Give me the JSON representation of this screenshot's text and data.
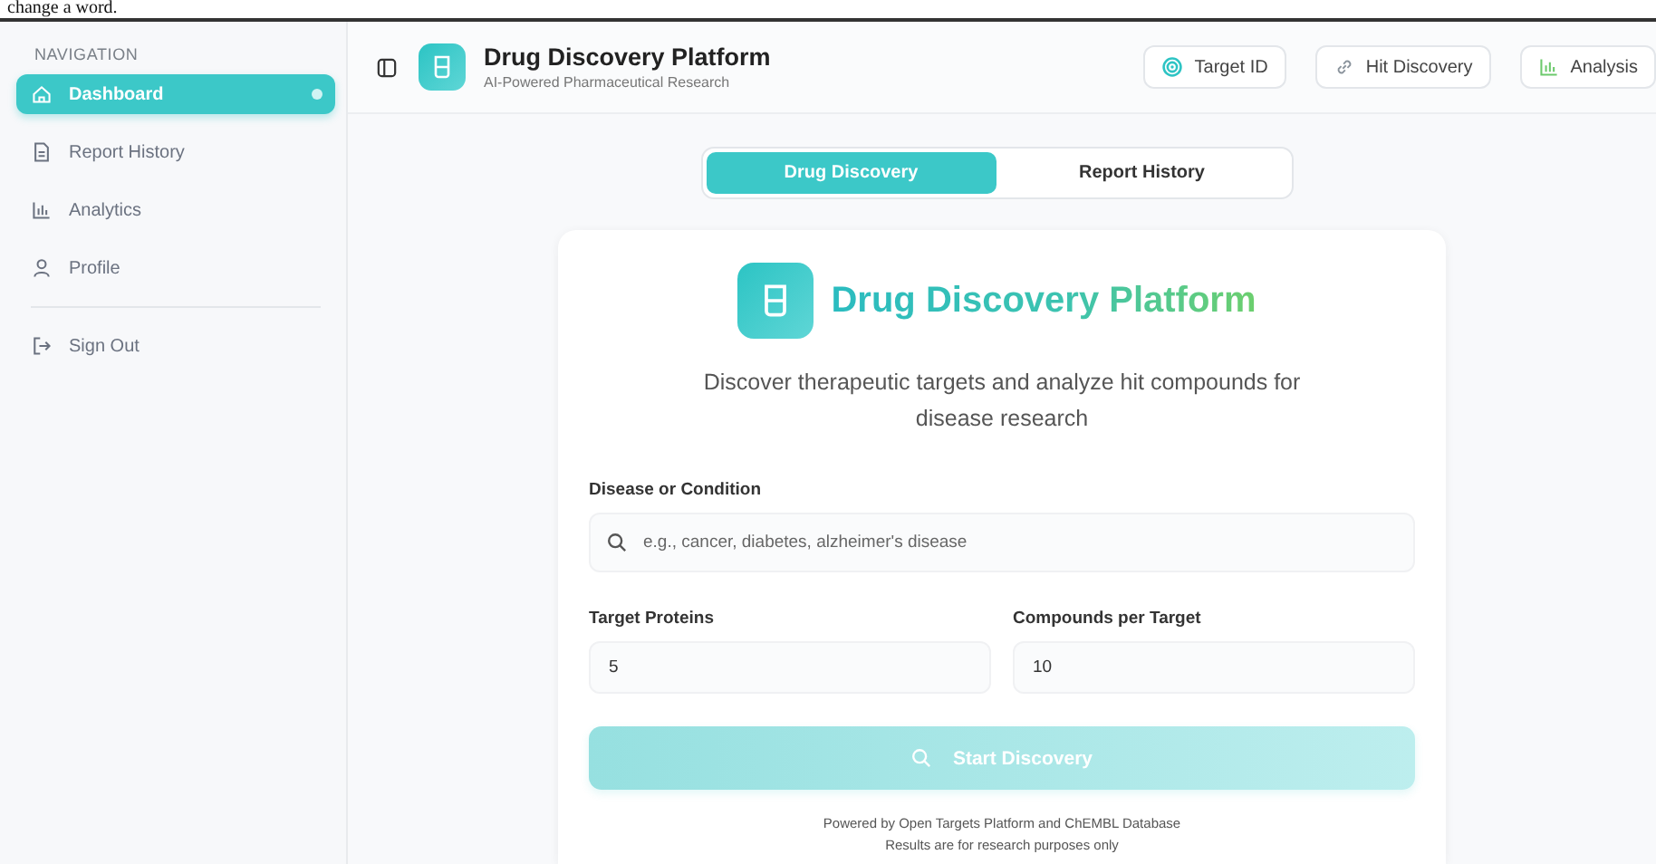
{
  "top_fragment": "change a word.",
  "sidebar": {
    "heading": "NAVIGATION",
    "items": [
      {
        "label": "Dashboard",
        "selected": true
      },
      {
        "label": "Report History",
        "selected": false
      },
      {
        "label": "Analytics",
        "selected": false
      },
      {
        "label": "Profile",
        "selected": false
      }
    ],
    "sign_out": "Sign Out"
  },
  "header": {
    "title": "Drug Discovery Platform",
    "subtitle": "AI-Powered Pharmaceutical Research",
    "buttons": [
      {
        "label": "Target ID"
      },
      {
        "label": "Hit Discovery"
      },
      {
        "label": "Analysis"
      }
    ]
  },
  "tabs": [
    {
      "label": "Drug Discovery",
      "selected": true
    },
    {
      "label": "Report History",
      "selected": false
    }
  ],
  "card": {
    "title": "Drug Discovery Platform",
    "description": "Discover therapeutic targets and analyze hit compounds for disease research",
    "disease": {
      "label": "Disease or Condition",
      "placeholder": "e.g., cancer, diabetes, alzheimer's disease"
    },
    "targets": {
      "label": "Target Proteins",
      "value": "5"
    },
    "compounds": {
      "label": "Compounds per Target",
      "value": "10"
    },
    "start_button": {
      "label": "Start Discovery",
      "disabled": true
    },
    "footer": [
      "Powered by Open Targets Platform and ChEMBL Database",
      "Results are for research purposes only"
    ]
  }
}
